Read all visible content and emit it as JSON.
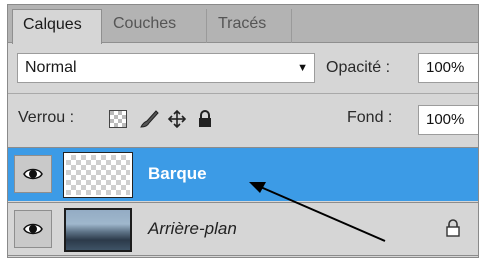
{
  "tabs": [
    {
      "label": "Calques",
      "active": true
    },
    {
      "label": "Couches",
      "active": false
    },
    {
      "label": "Tracés",
      "active": false
    }
  ],
  "blend_mode": {
    "value": "Normal"
  },
  "opacity": {
    "label": "Opacité :",
    "value": "100%"
  },
  "lock": {
    "label": "Verrou :",
    "icons": [
      "lock-transparent-pixels-icon",
      "lock-image-pixels-icon",
      "lock-position-icon",
      "lock-all-icon"
    ]
  },
  "fill": {
    "label": "Fond :",
    "value": "100%"
  },
  "layers": [
    {
      "name": "Barque",
      "visible": true,
      "selected": true,
      "locked": false
    },
    {
      "name": "Arrière-plan",
      "visible": true,
      "selected": false,
      "locked": true
    }
  ],
  "colors": {
    "selection": "#3c9be6",
    "panel": "#d6d6d6",
    "annotation_arrow": "#000000"
  }
}
